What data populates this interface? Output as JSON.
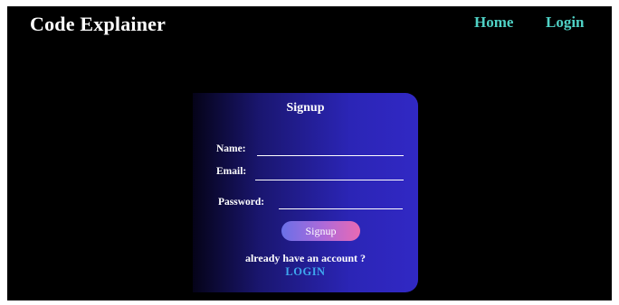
{
  "header": {
    "brand": "Code Explainer",
    "nav": [
      {
        "label": "Home"
      },
      {
        "label": "Login"
      }
    ]
  },
  "signup_form": {
    "title": "Signup",
    "fields": [
      {
        "label": "Name:",
        "value": ""
      },
      {
        "label": "Email:",
        "value": ""
      },
      {
        "label": "Password:",
        "value": ""
      }
    ],
    "submit_label": "Signup",
    "account_prompt": "already have an account ?",
    "login_link": "LOGIN"
  },
  "colors": {
    "background": "#000000",
    "nav_link": "#4fd1c5",
    "card_gradient_end": "#3128c4",
    "button_gradient": [
      "#6a70e8",
      "#e96ab3"
    ],
    "login_link": "#3ea7ee"
  }
}
